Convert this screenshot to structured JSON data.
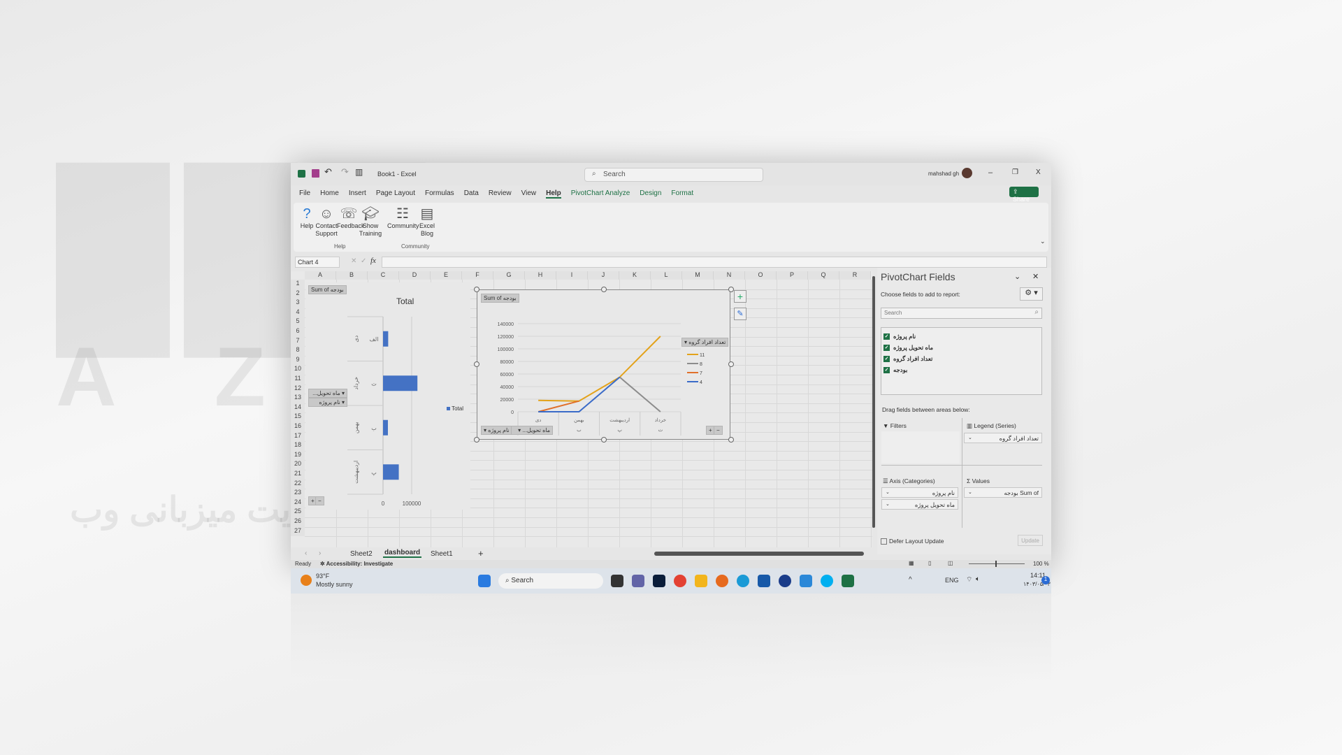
{
  "watermark": {
    "brand": "AZARSYS",
    "tagline": "سرویس بی نهایت میزبانی وب"
  },
  "titlebar": {
    "doc_title": "Book1 - Excel",
    "search_placeholder": "Search",
    "user": "mahshad gh",
    "minimize": "–",
    "restore": "❐",
    "close": "X"
  },
  "menu": {
    "items": [
      "File",
      "Home",
      "Insert",
      "Page Layout",
      "Formulas",
      "Data",
      "Review",
      "View",
      "Help"
    ],
    "active": "Help",
    "contextual": [
      "PivotChart Analyze",
      "Design",
      "Format"
    ],
    "share": "Share"
  },
  "ribbon": {
    "buttons": [
      {
        "icon": "help-icon",
        "label": "Help"
      },
      {
        "icon": "contact-support-icon",
        "label": "Contact Support"
      },
      {
        "icon": "feedback-icon",
        "label": "Feedback"
      },
      {
        "icon": "show-training-icon",
        "label": "Show Training"
      },
      {
        "icon": "community-icon",
        "label": "Community"
      },
      {
        "icon": "excel-blog-icon",
        "label": "Excel Blog"
      }
    ],
    "groups": [
      "Help",
      "Community"
    ]
  },
  "formula_bar": {
    "name_box": "Chart 4",
    "fx": "fx",
    "value": ""
  },
  "columns": [
    "A",
    "B",
    "C",
    "D",
    "E",
    "F",
    "G",
    "H",
    "I",
    "J",
    "K",
    "L",
    "M",
    "N",
    "O",
    "P",
    "Q",
    "R"
  ],
  "rows": 27,
  "bar_chart": {
    "title": "Total",
    "value_button": "Sum of بودجه",
    "field_buttons": [
      "ماه تحویل...",
      "نام پروژه"
    ],
    "legend": "Total",
    "chart_data": {
      "type": "bar",
      "orientation": "horizontal",
      "title": "Total",
      "categories": [
        {
          "outer": "دی",
          "inner": "الف"
        },
        {
          "outer": "خرداد",
          "inner": "ت"
        },
        {
          "outer": "بهمن",
          "inner": "ب"
        },
        {
          "outer": "اردیبهشت",
          "inner": "پ"
        }
      ],
      "series": [
        {
          "name": "Total",
          "values": [
            18000,
            120000,
            17000,
            55000
          ]
        }
      ],
      "xticks": [
        0,
        100000
      ],
      "xlim": [
        0,
        180000
      ],
      "color": "#4472c4",
      "legend_position": "right"
    }
  },
  "line_chart": {
    "value_button": "Sum of بودجه",
    "legend_title": "تعداد افراد گروه",
    "field_buttons": [
      "نام پروژه",
      "ماه تحویل..."
    ],
    "chart_data": {
      "type": "line",
      "categories": [
        "دی",
        "بهمن",
        "اردیبهشت",
        "خرداد"
      ],
      "outer_categories": [
        "",
        "ب",
        "پ",
        "ت"
      ],
      "yticks": [
        0,
        20000,
        40000,
        60000,
        80000,
        100000,
        120000,
        140000
      ],
      "ylim": [
        0,
        140000
      ],
      "grid": true,
      "legend_position": "right",
      "series": [
        {
          "name": "11",
          "color": "#e3a21a",
          "values": [
            18000,
            17000,
            55000,
            120000
          ]
        },
        {
          "name": "8",
          "color": "#8c8c8c",
          "values": [
            null,
            null,
            55000,
            0
          ]
        },
        {
          "name": "7",
          "color": "#e0702a",
          "values": [
            0,
            17000,
            null,
            null
          ]
        },
        {
          "name": "4",
          "color": "#3a6bc8",
          "values": [
            0,
            0,
            55000,
            null
          ]
        }
      ]
    }
  },
  "pane": {
    "title": "PivotChart Fields",
    "choose": "Choose fields to add to report:",
    "search_placeholder": "Search",
    "fields": [
      "نام پروژه",
      "ماه تحویل پروژه",
      "تعداد افراد گروه",
      "بودجه"
    ],
    "drag": "Drag fields between areas below:",
    "filters": "Filters",
    "legend": "Legend (Series)",
    "axis": "Axis (Categories)",
    "values": "Values",
    "legend_items": [
      "تعداد افراد گروه"
    ],
    "axis_items": [
      "نام پروژه",
      "ماه تحویل پروژه"
    ],
    "value_items": [
      "Sum of بودجه"
    ],
    "defer": "Defer Layout Update",
    "update": "Update"
  },
  "sheets": {
    "tabs": [
      "Sheet2",
      "dashboard",
      "Sheet1"
    ],
    "active": "dashboard",
    "add": "+"
  },
  "status": {
    "ready": "Ready",
    "accessibility": "Accessibility: Investigate",
    "zoom": "100 %"
  },
  "taskbar": {
    "temp": "93°F",
    "weather": "Mostly sunny",
    "search": "Search",
    "lang": "ENG",
    "time": "14:11",
    "date": "۱۴۰۳/۰۵/۰۳",
    "notif": "1"
  }
}
